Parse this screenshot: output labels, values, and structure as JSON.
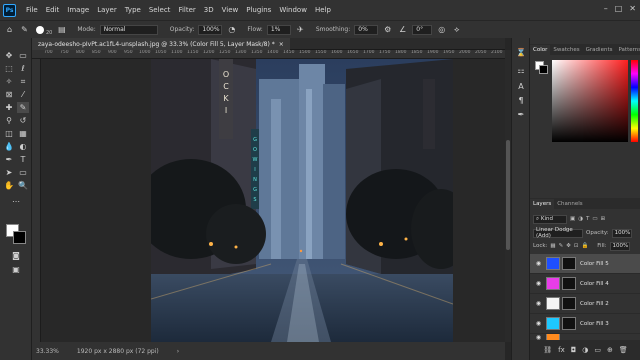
{
  "menu": {
    "logo": "Ps",
    "items": [
      "File",
      "Edit",
      "Image",
      "Layer",
      "Type",
      "Select",
      "Filter",
      "3D",
      "View",
      "Plugins",
      "Window",
      "Help"
    ],
    "window_controls": [
      "–",
      "□",
      "✕"
    ]
  },
  "options": {
    "brush_size": "20",
    "mode_label": "Mode:",
    "mode_value": "Normal",
    "opacity_label": "Opacity:",
    "opacity_value": "100%",
    "flow_label": "Flow:",
    "flow_value": "1%",
    "smoothing_label": "Smoothing:",
    "smoothing_value": "0%",
    "angle_value": "0°"
  },
  "document": {
    "tab_title": "zaya-odeesho-pIvPt.ac1fL4-unsplash.jpg @ 33.3% (Color Fill 5, Layer Mask/8) *",
    "close": "×"
  },
  "ruler_ticks": [
    "700",
    "750",
    "800",
    "850",
    "900",
    "950",
    "1000",
    "1050",
    "1100",
    "1150",
    "1200",
    "1250",
    "1300",
    "1350",
    "1400",
    "1450",
    "1500",
    "1550",
    "1600",
    "1650",
    "1700",
    "1750",
    "1800",
    "1850",
    "1900",
    "1950",
    "2000",
    "2050",
    "2100"
  ],
  "status": {
    "zoom": "33.33%",
    "dimensions": "1920 px x 2880 px (72 ppi)"
  },
  "color_panel": {
    "tabs": [
      "Color",
      "Swatches",
      "Gradients",
      "Patterns"
    ]
  },
  "layers_panel": {
    "tabs": [
      "Layers",
      "Channels"
    ],
    "kind_label": "Kind",
    "blend_mode": "Linear Dodge (Add)",
    "opacity_label": "Opacity:",
    "opacity_value": "100%",
    "lock_label": "Lock:",
    "fill_label": "Fill:",
    "fill_value": "100%",
    "layers": [
      {
        "name": "Color Fill 5",
        "color": "#1e4fff",
        "selected": true
      },
      {
        "name": "Color Fill 4",
        "color": "#e83de8",
        "selected": false
      },
      {
        "name": "Color Fill 2",
        "color": "#f4f4f4",
        "selected": false
      },
      {
        "name": "Color Fill 3",
        "color": "#1ec8ff",
        "selected": false
      },
      {
        "name": "",
        "color": "#ff8a1e",
        "selected": false
      }
    ]
  }
}
